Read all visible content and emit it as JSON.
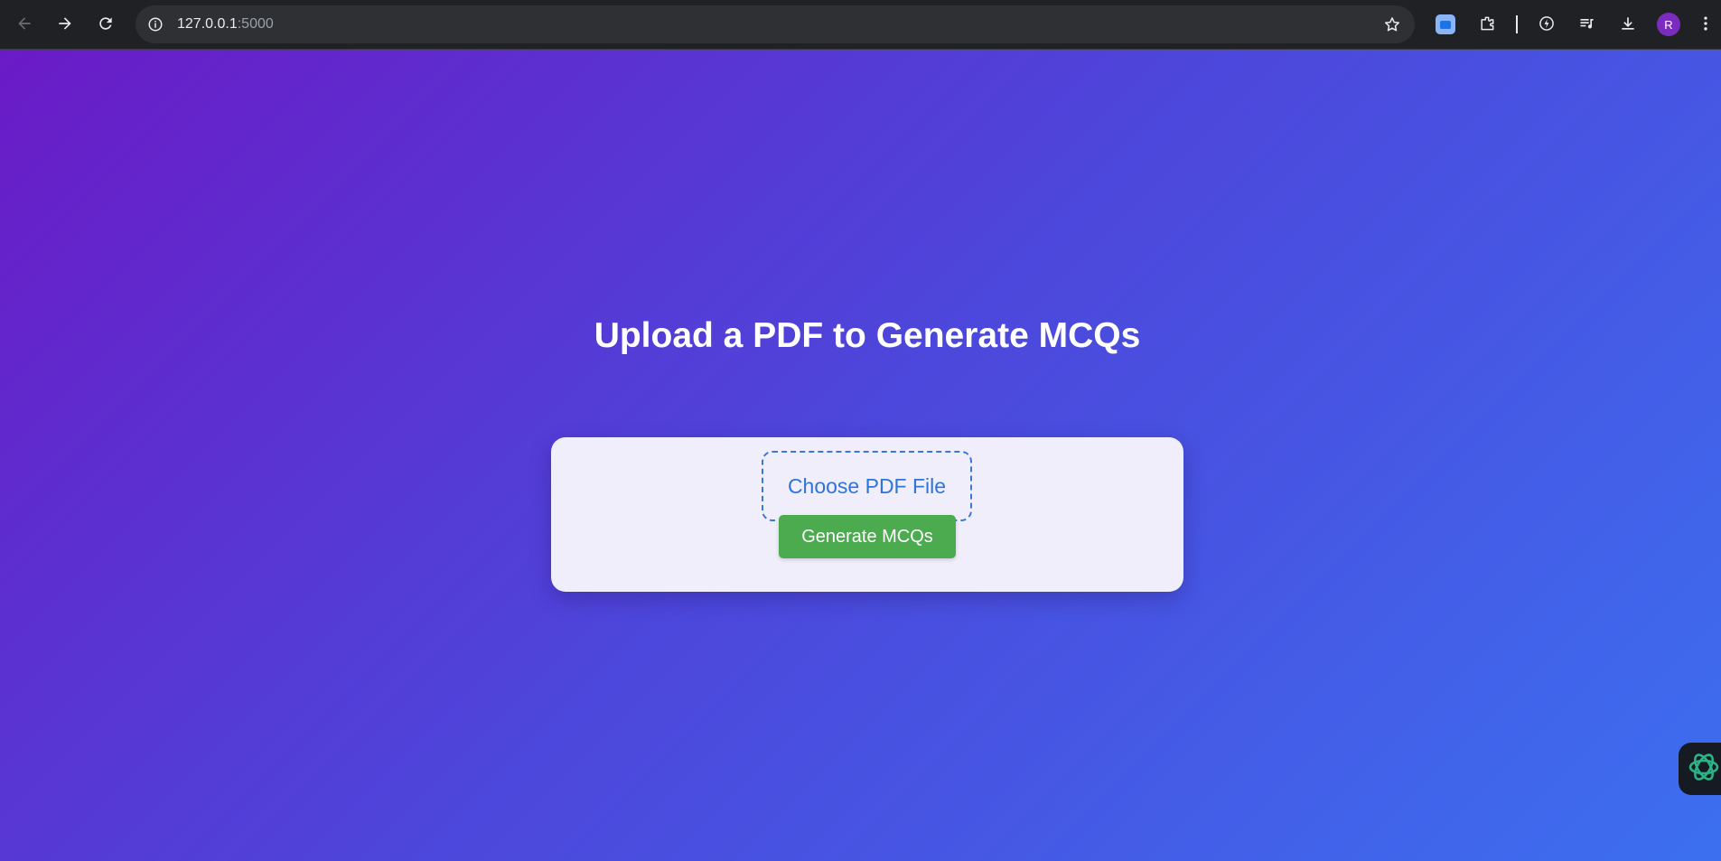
{
  "browser": {
    "url_host": "127.0.0.1",
    "url_port": ":5000",
    "profile_initial": "R"
  },
  "page": {
    "title": "Upload a PDF to Generate MCQs",
    "file_input_label": "Choose PDF File",
    "submit_label": "Generate MCQs"
  },
  "colors": {
    "gradient_start": "#6a1bc6",
    "gradient_end": "#3c6ff0",
    "card_bg": "#efeefa",
    "file_label": "#2f74d8",
    "submit_bg": "#4caa4f"
  }
}
